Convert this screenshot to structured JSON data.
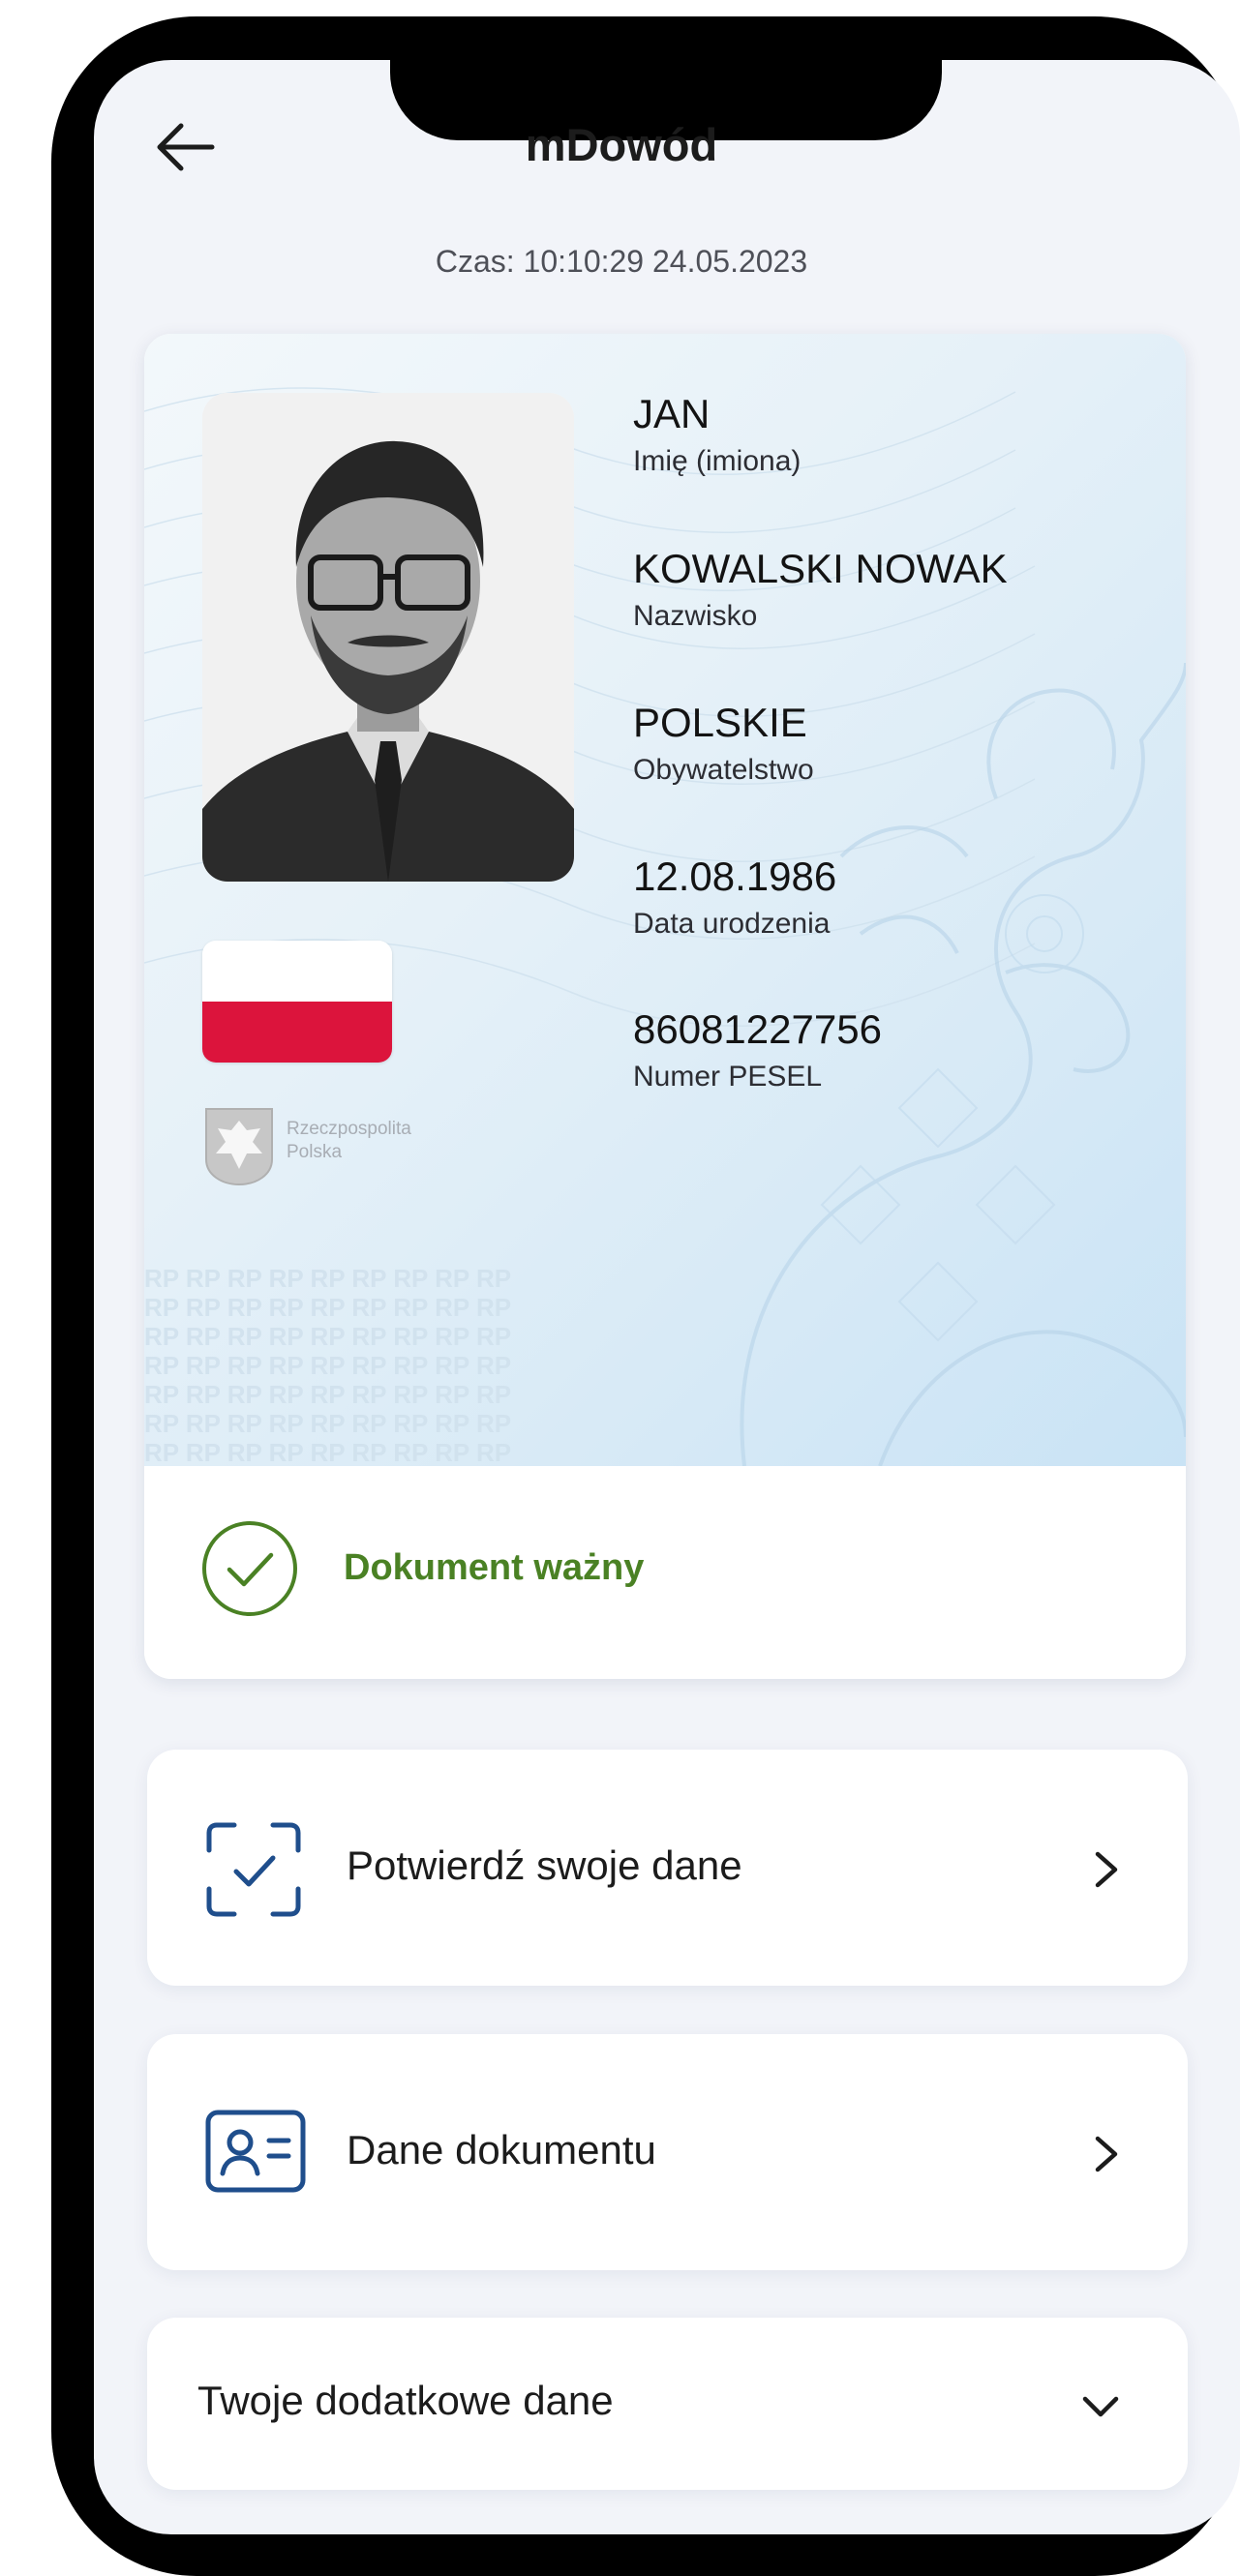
{
  "header": {
    "title": "mDowód",
    "time": "Czas: 10:10:29 24.05.2023"
  },
  "id_card": {
    "fields": [
      {
        "value": "JAN",
        "label": "Imię (imiona)"
      },
      {
        "value": "KOWALSKI NOWAK",
        "label": "Nazwisko"
      },
      {
        "value": "POLSKIE",
        "label": "Obywatelstwo"
      },
      {
        "value": "12.08.1986",
        "label": "Data urodzenia"
      },
      {
        "value": "86081227756",
        "label": "Numer PESEL"
      }
    ],
    "emblem_text_line1": "Rzeczpospolita",
    "emblem_text_line2": "Polska",
    "watermark_text": "RP RP RP RP RP RP RP RP RP",
    "status": "Dokument ważny"
  },
  "actions": {
    "confirm_label": "Potwierdź swoje dane",
    "document_data_label": "Dane dokumentu",
    "additional_label": "Twoje dodatkowe dane"
  },
  "colors": {
    "accent_blue": "#1f4e8c",
    "valid_green": "#4a8124",
    "flag_red": "#dc143c"
  }
}
